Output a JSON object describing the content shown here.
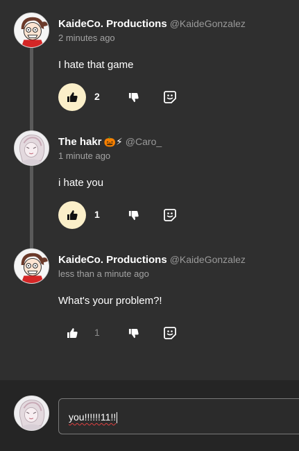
{
  "comments": [
    {
      "author": "KaideCo. Productions",
      "handle": "@KaideGonzalez",
      "timestamp": "2 minutes ago",
      "text": "I hate that game",
      "likes": "2",
      "liked": true,
      "avatar_icon": "cartoon-girl-avatar"
    },
    {
      "author": "The hakr",
      "emoji": "🎃⚡",
      "handle": "@Caro_",
      "timestamp": "1 minute ago",
      "text": "i hate you",
      "likes": "1",
      "liked": true,
      "avatar_icon": "sketch-character-avatar"
    },
    {
      "author": "KaideCo. Productions",
      "handle": "@KaideGonzalez",
      "timestamp": "less than a minute ago",
      "text": "What's your problem?!",
      "likes": "1",
      "liked": false,
      "avatar_icon": "cartoon-girl-avatar"
    }
  ],
  "composer": {
    "value": "you!!!!!!11!!",
    "avatar_icon": "sketch-character-avatar"
  },
  "colors": {
    "background": "#2f2f2f",
    "composer_bg": "#252525",
    "like_active_bg": "#fbefc9",
    "muted_text": "#a3a3a3"
  },
  "icons": {
    "like": "thumbs-up-icon",
    "dislike": "thumbs-down-icon",
    "react": "emoji-react-icon"
  }
}
